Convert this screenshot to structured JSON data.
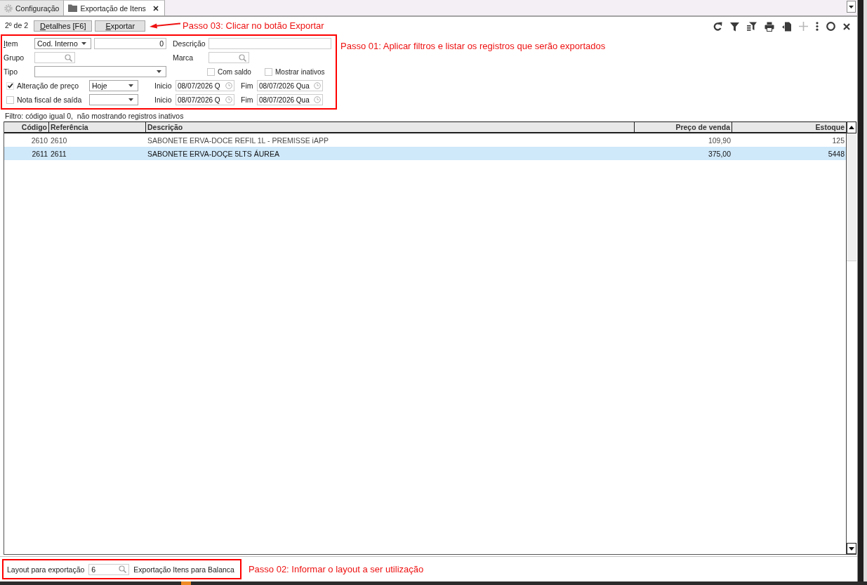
{
  "tabs": [
    {
      "label": "Configuração",
      "kind": "settings",
      "selected": false,
      "closable": false
    },
    {
      "label": "Exportação de Itens",
      "kind": "folder",
      "selected": true,
      "closable": true
    }
  ],
  "toolbar": {
    "record_position": "2º de 2",
    "buttons": [
      {
        "label": "Detalhes [F6]",
        "mnemonic": true
      },
      {
        "label": "Exportar",
        "mnemonic": true
      }
    ],
    "annotation": "Passo 03: Clicar no botão Exportar"
  },
  "filters": {
    "highlighted": true,
    "annotation": "Passo 01: Aplicar filtros e listar os registros que serão exportados",
    "item": {
      "label": "Item",
      "mnemonic": true,
      "mode": "Cod. Interno",
      "value": "0"
    },
    "description": {
      "label": "Descrição"
    },
    "group": {
      "label": "Grupo"
    },
    "brand": {
      "label": "Marca"
    },
    "type": {
      "label": "Tipo"
    },
    "options": [
      {
        "label": "Com saldo",
        "checked": false
      },
      {
        "label": "Mostrar inativos",
        "checked": false
      }
    ],
    "date_filters": [
      {
        "label": "Alteração de preço",
        "checked": true,
        "period": "Hoje",
        "start_label": "Inicio",
        "start": "08/07/2026 Q",
        "end_label": "Fim",
        "end": "08/07/2026 Qua"
      },
      {
        "label": "Nota fiscal de saída",
        "checked": false,
        "start_label": "Inicio",
        "start": "08/07/2026 Q",
        "end_label": "Fim",
        "end": "08/07/2026 Qua"
      }
    ]
  },
  "filter_summary": "Filtro: código igual 0,  não mostrando registros inativos",
  "table": {
    "columns": [
      {
        "label": "Código",
        "kind": "number"
      },
      {
        "label": "Referência",
        "kind": "text"
      },
      {
        "label": "Descrição",
        "kind": "text"
      },
      {
        "label": "Preço de venda",
        "kind": "number"
      },
      {
        "label": "Estoque",
        "kind": "number"
      }
    ],
    "rows": [
      {
        "selected": false,
        "cells": [
          "2610",
          "2610",
          "SABONETE ERVA-DOCE REFIL 1L - PREMISSE iAPP",
          "109,90",
          "125"
        ]
      },
      {
        "selected": true,
        "cells": [
          "2611",
          "2611",
          "SABONETE ERVA-DOÇE 5LTS ÁUREA",
          "375,00",
          "5448"
        ]
      }
    ]
  },
  "layout": {
    "highlighted": true,
    "label": "Layout para exportação",
    "value": "6",
    "description": "Exportação Itens para Balanca",
    "annotation": "Passo 02: Informar o layout a ser utilização"
  }
}
